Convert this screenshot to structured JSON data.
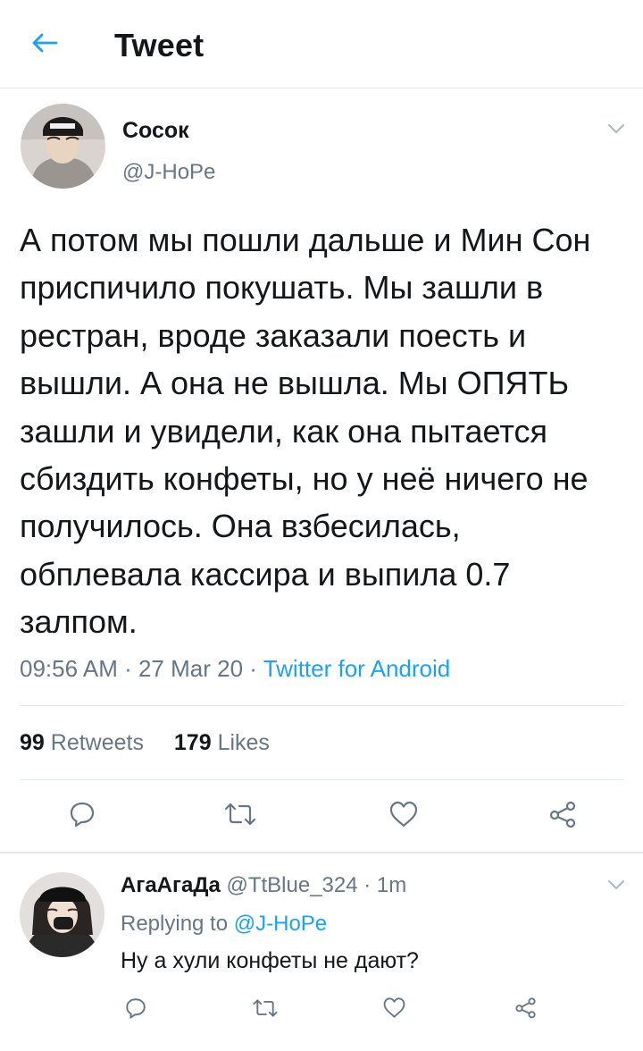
{
  "header": {
    "title": "Tweet",
    "back_icon": "arrow-left-icon"
  },
  "colors": {
    "accent": "#1da1f2",
    "muted": "#657786",
    "text": "#14171a",
    "divider": "#e1e8ed"
  },
  "tweet": {
    "author_name": "Сосок",
    "author_handle": "@J-HoPe",
    "text": "А потом мы пошли дальше и Мин Сон приспичило покушать. Мы зашли в рестран, вроде заказали поесть и вышли. А она не вышла. Мы ОПЯТЬ зашли и увидели, как она пытается сбиздить конфеты, но у неё ничего не получилось. Она взбесилась, обплевала кассира и выпила 0.7 залпом.",
    "time": "09:56 AM",
    "separator": " · ",
    "date": "27 Mar 20",
    "source": "Twitter for Android",
    "retweets_count": "99",
    "retweets_label": "Retweets",
    "likes_count": "179",
    "likes_label": "Likes"
  },
  "reply": {
    "author_name": "АгаАгаДа",
    "author_handle": "@TtBlue_324",
    "separator": " · ",
    "time": "1m",
    "replying_label": "Replying to",
    "replying_handle": "@J-HoPe",
    "text": "Ну а хули конфеты не дают?"
  },
  "actions": [
    "reply-icon",
    "retweet-icon",
    "like-icon",
    "share-icon"
  ]
}
